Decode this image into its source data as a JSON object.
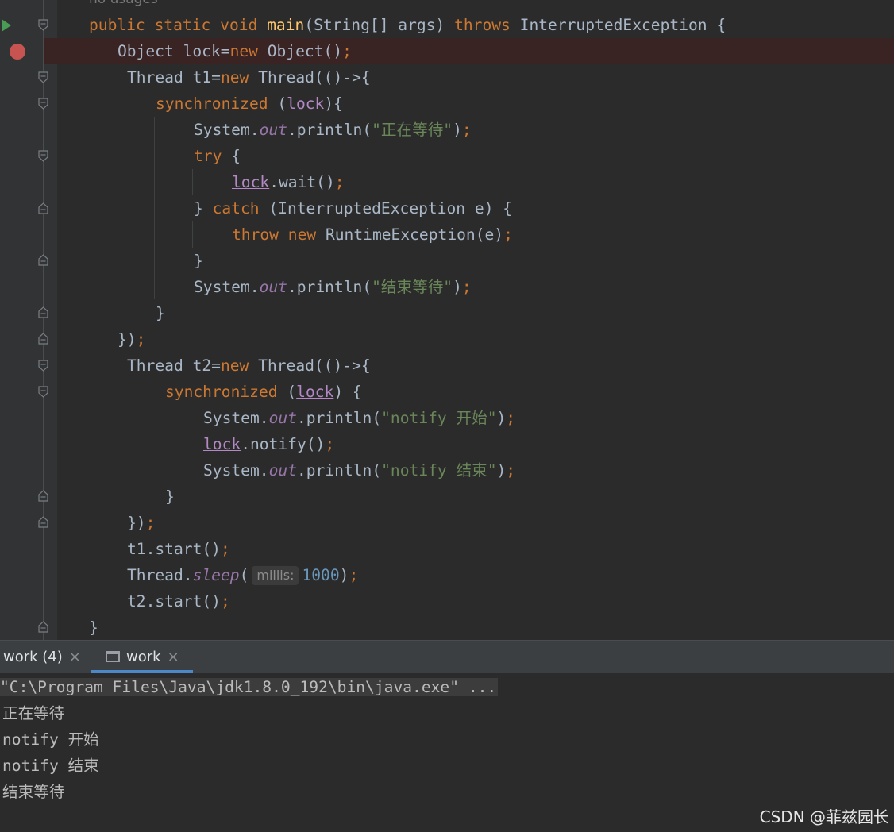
{
  "editor": {
    "usage_hint": "no usages",
    "lines": {
      "l1": {
        "a": "public static void ",
        "b": "main",
        "c": "(String[] args) ",
        "d": "throws",
        "e": " InterruptedException {"
      },
      "l2": {
        "a": "Object lock=",
        "b": "new",
        "c": " Object()",
        "d": ";"
      },
      "l3": {
        "a": "Thread t1=",
        "b": "new",
        "c": " Thread(()->{"
      },
      "l4": {
        "a": "synchronized",
        "b": " (",
        "c": "lock",
        "d": "){"
      },
      "l5": {
        "a": "System.",
        "b": "out",
        "c": ".println(",
        "d": "\"正在等待\"",
        "e": ")",
        "f": ";"
      },
      "l6": {
        "a": "try",
        "b": " {"
      },
      "l7": {
        "a": "lock",
        "b": ".wait()",
        "c": ";"
      },
      "l8": {
        "a": "} ",
        "b": "catch",
        "c": " (InterruptedException e) {"
      },
      "l9": {
        "a": "throw new",
        "b": " RuntimeException(e)",
        "c": ";"
      },
      "l10": {
        "a": "}"
      },
      "l11": {
        "a": "System.",
        "b": "out",
        "c": ".println(",
        "d": "\"结束等待\"",
        "e": ")",
        "f": ";"
      },
      "l12": {
        "a": "}"
      },
      "l13": {
        "a": "})",
        "b": ";"
      },
      "l14": {
        "a": "Thread t2=",
        "b": "new",
        "c": " Thread(()->{"
      },
      "l15": {
        "a": "synchronized",
        "b": " (",
        "c": "lock",
        "d": ") {"
      },
      "l16": {
        "a": "System.",
        "b": "out",
        "c": ".println(",
        "d": "\"notify 开始\"",
        "e": ")",
        "f": ";"
      },
      "l17": {
        "a": "lock",
        "b": ".notify()",
        "c": ";"
      },
      "l18": {
        "a": "System.",
        "b": "out",
        "c": ".println(",
        "d": "\"notify 结束\"",
        "e": ")",
        "f": ";"
      },
      "l19": {
        "a": "}"
      },
      "l20": {
        "a": "})",
        "b": ";"
      },
      "l21": {
        "a": "t1.start()",
        "b": ";"
      },
      "l22": {
        "a": "Thread.",
        "b": "sleep",
        "c": "(",
        "hint": "millis:",
        "d": "1000",
        "e": ")",
        "f": ";"
      },
      "l23": {
        "a": "t2.start()",
        "b": ";"
      },
      "l24": {
        "a": "}"
      }
    }
  },
  "run_panel": {
    "tabs": [
      {
        "label": "work (4)",
        "close": "×"
      },
      {
        "label": "work",
        "close": "×"
      }
    ],
    "console": {
      "command": "\"C:\\Program Files\\Java\\jdk1.8.0_192\\bin\\java.exe\" ...",
      "output": [
        "正在等待",
        "notify 开始",
        "notify 结束",
        "结束等待"
      ]
    }
  },
  "watermark": "CSDN @菲兹园长",
  "colors": {
    "editor_bg": "#2b2b2b",
    "keyword": "#cc7832",
    "string": "#6a8759",
    "breakpoint": "#c75450",
    "active_tab": "#4a88c7"
  }
}
